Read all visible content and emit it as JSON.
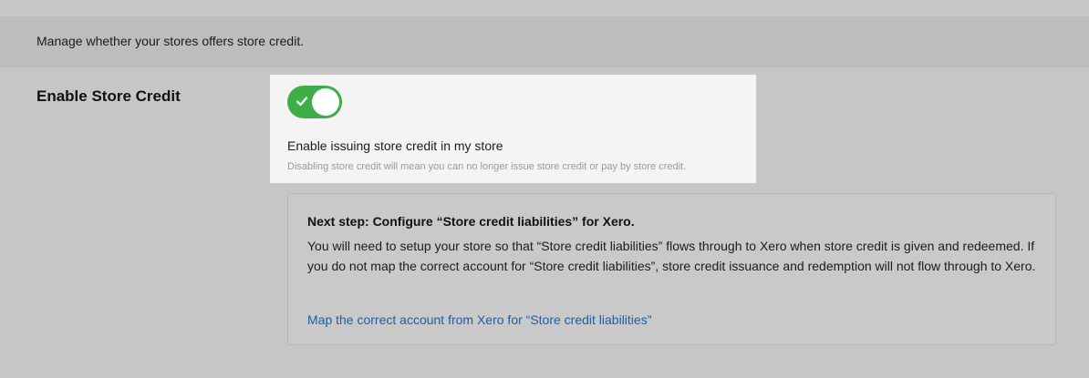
{
  "header": {
    "description": "Manage whether your stores offers store credit."
  },
  "setting": {
    "label": "Enable Store Credit",
    "toggle": {
      "state": "on",
      "icon": "check-icon",
      "accent_color": "#3fae49"
    },
    "option_title": "Enable issuing store credit in my store",
    "option_help": "Disabling store credit will mean you can no longer issue store credit or pay by store credit."
  },
  "next_step": {
    "heading": "Next step: Configure “Store credit liabilities” for Xero.",
    "body": "You will need to setup your store so that “Store credit liabilities” flows through to Xero when store credit is given and redeemed. If you do not map the correct account for “Store credit liabilities”, store credit issuance and redemption will not flow through to Xero.",
    "link_text": "Map the correct account from Xero for “Store credit liabilities”",
    "link_color": "#1b5fa8"
  }
}
